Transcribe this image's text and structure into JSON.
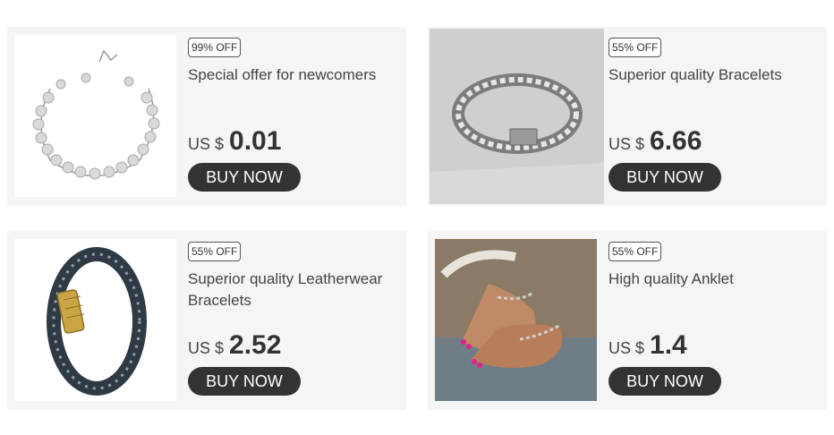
{
  "products": [
    {
      "badge": "99% OFF",
      "title": "Special offer for newcomers",
      "currency": "US $",
      "price": "0.01",
      "button": "BUY NOW"
    },
    {
      "badge": "55% OFF",
      "title": "Superior quality Bracelets",
      "currency": "US $",
      "price": "6.66",
      "button": "BUY NOW"
    },
    {
      "badge": "55% OFF",
      "title": "Superior quality Leatherwear Bracelets",
      "currency": "US $",
      "price": "2.52",
      "button": "BUY NOW"
    },
    {
      "badge": "55% OFF",
      "title": "High quality Anklet",
      "currency": "US $",
      "price": "1.4",
      "button": "BUY NOW"
    }
  ],
  "colors": {
    "card_bg": "#f5f5f5",
    "button_bg": "#333333",
    "button_text": "#ffffff"
  }
}
